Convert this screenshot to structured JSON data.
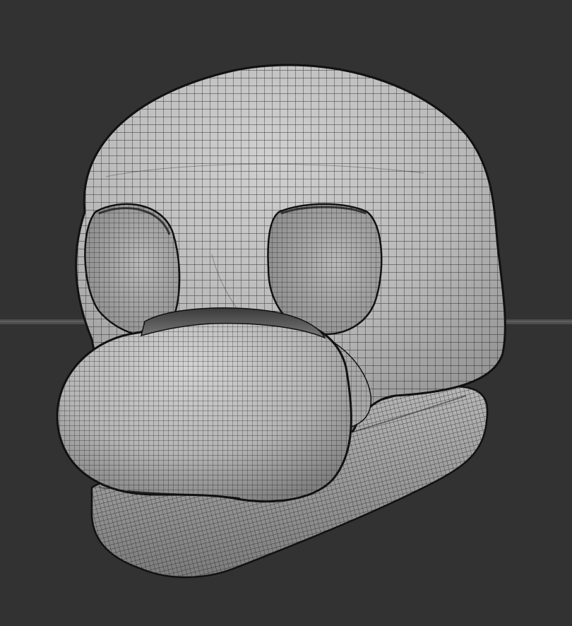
{
  "viewport": {
    "background": "#323232",
    "horizon_color": "#5a5a5a",
    "surface_color": "#b7b7b7",
    "wire_color": "#1a1a1a",
    "outline_color": "#111111"
  },
  "model": {
    "parts": [
      "head-shell",
      "left-eye-socket",
      "right-eye-socket",
      "jaw",
      "muzzle"
    ]
  }
}
